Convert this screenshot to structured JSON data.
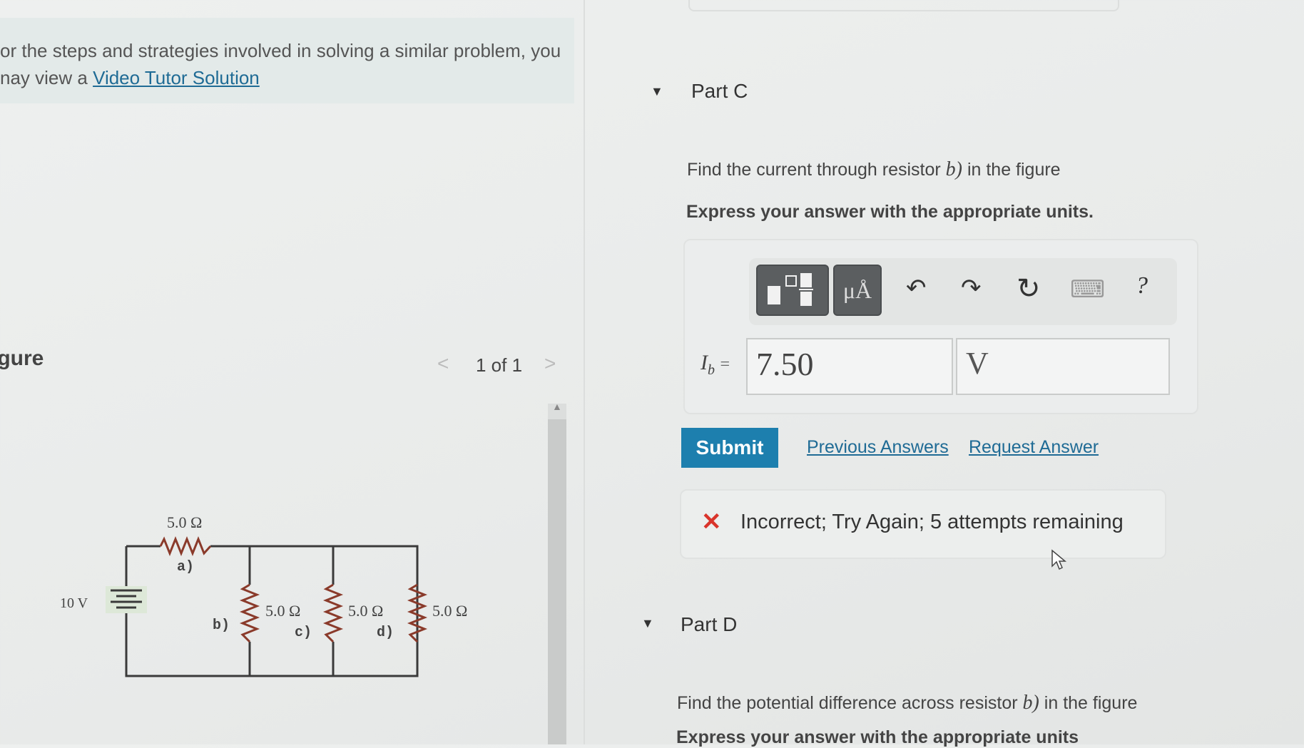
{
  "left_panel": {
    "hint_line1": "or the steps and strategies involved in solving a similar problem, you",
    "hint_line2_prefix": "nay view a ",
    "hint_link": "Video Tutor Solution",
    "figure_heading": "igure",
    "pager": {
      "prev": "<",
      "label": "1 of 1",
      "next": ">"
    },
    "circuit": {
      "battery_label": "10 V",
      "resistor_a_value": "5.0 Ω",
      "resistor_a_label": "a)",
      "resistor_b_label": "b)",
      "resistor_c_value": "5.0 Ω",
      "resistor_c_label": "c)",
      "resistor_d_value": "5.0 Ω",
      "resistor_d_label": "d)",
      "resistor_e_value": "5.0 Ω"
    }
  },
  "part_c": {
    "toggle": "▼",
    "title": "Part C",
    "question_prefix": "Find the current through resistor ",
    "question_var": "b)",
    "question_suffix": " in the figure",
    "instruction": "Express your answer with the appropriate units.",
    "toolbar": {
      "units_button": "μÅ",
      "undo": "↶",
      "redo": "↷",
      "reset": "↻",
      "keyboard": "⌨",
      "help": "?"
    },
    "variable_label": "I",
    "variable_subscript": "b",
    "equals": "=",
    "value": "7.50",
    "unit": "V",
    "submit_label": "Submit",
    "previous_answers": "Previous Answers",
    "request_answer": "Request Answer",
    "feedback_icon": "✕",
    "feedback_text": "Incorrect; Try Again; 5 attempts remaining"
  },
  "part_d": {
    "toggle": "▼",
    "title": "Part D",
    "question_prefix": "Find the potential difference across resistor ",
    "question_var": "b)",
    "question_suffix": " in the figure",
    "instruction": "Express your answer with the appropriate units"
  },
  "colors": {
    "accent": "#1d7fae",
    "link": "#1f6b95",
    "error": "#d9342b"
  }
}
